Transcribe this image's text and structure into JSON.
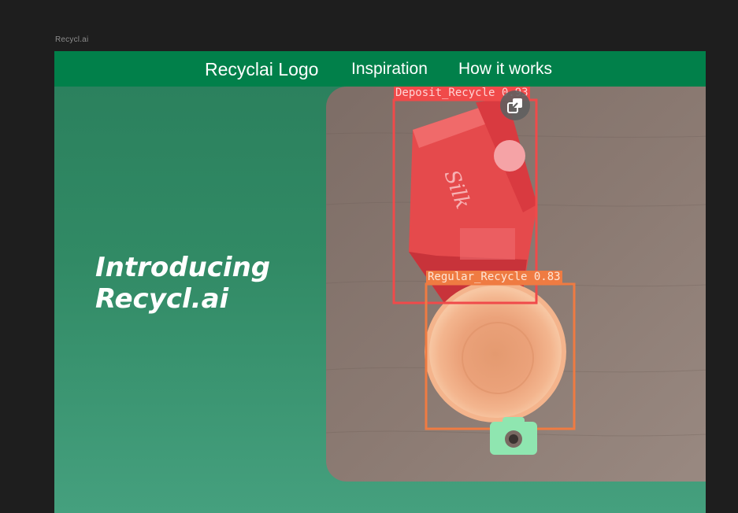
{
  "canvas": {
    "frame_name": "Recycl.ai"
  },
  "nav": {
    "logo": "Recyclai Logo",
    "inspiration": "Inspiration",
    "how_it_works": "How it works"
  },
  "hero": {
    "title_line1": "Introducing",
    "title_line2": "Recycl.ai"
  },
  "detections": [
    {
      "label": "Deposit_Recycle",
      "score": "0.93",
      "text": "Deposit_Recycle 0.93",
      "color": "#f04a4a"
    },
    {
      "label": "Regular_Recycle",
      "score": "0.83",
      "text": "Regular_Recycle 0.83",
      "color": "#ef7b42"
    }
  ],
  "icons": {
    "expand": "expand-images-icon",
    "camera": "camera-icon"
  },
  "colors": {
    "canvas_bg": "#1e1e1e",
    "navbar": "#01804a",
    "hero_top": "#2a7f5c",
    "hero_bottom": "#45a07e",
    "camera_button": "#8fe6b0"
  }
}
